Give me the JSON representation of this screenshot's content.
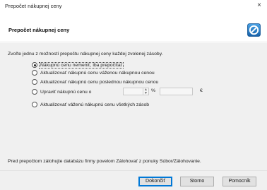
{
  "window": {
    "title": "Prepočet nákupnej ceny",
    "close_glyph": "×"
  },
  "header": {
    "heading": "Prepočet nákupnej ceny",
    "logo_icon": "app-logo-icon",
    "accent_color": "#1e73be"
  },
  "body": {
    "instruction": "Zvoľte jednu z možností prepočtu nákupnej ceny každej zvolenej zásoby.",
    "options": [
      {
        "label": "Nákupnú cenu nemeniť, iba prepočítať",
        "selected": true
      },
      {
        "label": "Aktualizovať nákupnú cenu váženou nákupnou cenou",
        "selected": false
      },
      {
        "label": "Aktualizovať nákupnú cenu poslednou nákupnou cenou",
        "selected": false
      },
      {
        "label": "Upraviť nákupnú cenu o",
        "selected": false
      },
      {
        "label": "Aktualizovať váženú nákupnú cenu všetkých zásob",
        "selected": false
      }
    ],
    "percent_symbol": "%",
    "currency_symbol": "€",
    "percent_value": "",
    "amount_value": "",
    "note": "Pred prepočtom zálohujte databázu firmy povelom Zálohovať z ponuky Súbor/Zálohovanie."
  },
  "footer": {
    "finish_label": "Dokončiť",
    "cancel_label": "Storno",
    "help_label": "Pomocník"
  }
}
